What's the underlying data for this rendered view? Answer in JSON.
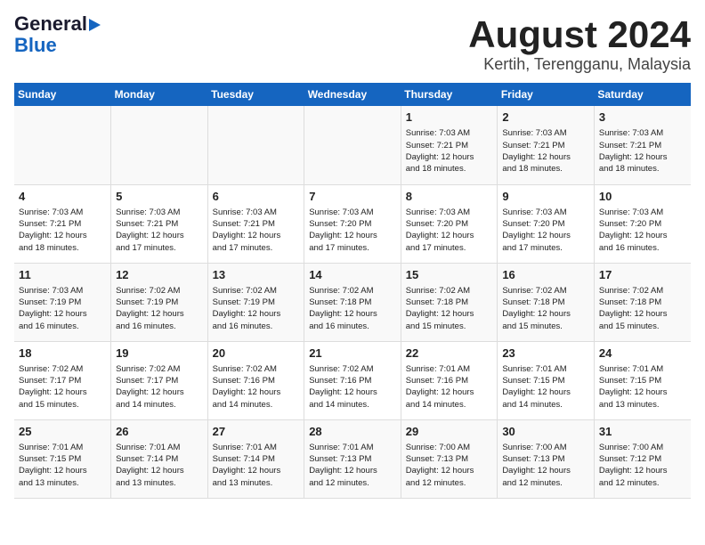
{
  "header": {
    "logo_line1": "General",
    "logo_line2": "Blue",
    "title": "August 2024",
    "subtitle": "Kertih, Terengganu, Malaysia"
  },
  "weekdays": [
    "Sunday",
    "Monday",
    "Tuesday",
    "Wednesday",
    "Thursday",
    "Friday",
    "Saturday"
  ],
  "weeks": [
    [
      {
        "day": "",
        "info": ""
      },
      {
        "day": "",
        "info": ""
      },
      {
        "day": "",
        "info": ""
      },
      {
        "day": "",
        "info": ""
      },
      {
        "day": "1",
        "info": "Sunrise: 7:03 AM\nSunset: 7:21 PM\nDaylight: 12 hours\nand 18 minutes."
      },
      {
        "day": "2",
        "info": "Sunrise: 7:03 AM\nSunset: 7:21 PM\nDaylight: 12 hours\nand 18 minutes."
      },
      {
        "day": "3",
        "info": "Sunrise: 7:03 AM\nSunset: 7:21 PM\nDaylight: 12 hours\nand 18 minutes."
      }
    ],
    [
      {
        "day": "4",
        "info": "Sunrise: 7:03 AM\nSunset: 7:21 PM\nDaylight: 12 hours\nand 18 minutes."
      },
      {
        "day": "5",
        "info": "Sunrise: 7:03 AM\nSunset: 7:21 PM\nDaylight: 12 hours\nand 17 minutes."
      },
      {
        "day": "6",
        "info": "Sunrise: 7:03 AM\nSunset: 7:21 PM\nDaylight: 12 hours\nand 17 minutes."
      },
      {
        "day": "7",
        "info": "Sunrise: 7:03 AM\nSunset: 7:20 PM\nDaylight: 12 hours\nand 17 minutes."
      },
      {
        "day": "8",
        "info": "Sunrise: 7:03 AM\nSunset: 7:20 PM\nDaylight: 12 hours\nand 17 minutes."
      },
      {
        "day": "9",
        "info": "Sunrise: 7:03 AM\nSunset: 7:20 PM\nDaylight: 12 hours\nand 17 minutes."
      },
      {
        "day": "10",
        "info": "Sunrise: 7:03 AM\nSunset: 7:20 PM\nDaylight: 12 hours\nand 16 minutes."
      }
    ],
    [
      {
        "day": "11",
        "info": "Sunrise: 7:03 AM\nSunset: 7:19 PM\nDaylight: 12 hours\nand 16 minutes."
      },
      {
        "day": "12",
        "info": "Sunrise: 7:02 AM\nSunset: 7:19 PM\nDaylight: 12 hours\nand 16 minutes."
      },
      {
        "day": "13",
        "info": "Sunrise: 7:02 AM\nSunset: 7:19 PM\nDaylight: 12 hours\nand 16 minutes."
      },
      {
        "day": "14",
        "info": "Sunrise: 7:02 AM\nSunset: 7:18 PM\nDaylight: 12 hours\nand 16 minutes."
      },
      {
        "day": "15",
        "info": "Sunrise: 7:02 AM\nSunset: 7:18 PM\nDaylight: 12 hours\nand 15 minutes."
      },
      {
        "day": "16",
        "info": "Sunrise: 7:02 AM\nSunset: 7:18 PM\nDaylight: 12 hours\nand 15 minutes."
      },
      {
        "day": "17",
        "info": "Sunrise: 7:02 AM\nSunset: 7:18 PM\nDaylight: 12 hours\nand 15 minutes."
      }
    ],
    [
      {
        "day": "18",
        "info": "Sunrise: 7:02 AM\nSunset: 7:17 PM\nDaylight: 12 hours\nand 15 minutes."
      },
      {
        "day": "19",
        "info": "Sunrise: 7:02 AM\nSunset: 7:17 PM\nDaylight: 12 hours\nand 14 minutes."
      },
      {
        "day": "20",
        "info": "Sunrise: 7:02 AM\nSunset: 7:16 PM\nDaylight: 12 hours\nand 14 minutes."
      },
      {
        "day": "21",
        "info": "Sunrise: 7:02 AM\nSunset: 7:16 PM\nDaylight: 12 hours\nand 14 minutes."
      },
      {
        "day": "22",
        "info": "Sunrise: 7:01 AM\nSunset: 7:16 PM\nDaylight: 12 hours\nand 14 minutes."
      },
      {
        "day": "23",
        "info": "Sunrise: 7:01 AM\nSunset: 7:15 PM\nDaylight: 12 hours\nand 14 minutes."
      },
      {
        "day": "24",
        "info": "Sunrise: 7:01 AM\nSunset: 7:15 PM\nDaylight: 12 hours\nand 13 minutes."
      }
    ],
    [
      {
        "day": "25",
        "info": "Sunrise: 7:01 AM\nSunset: 7:15 PM\nDaylight: 12 hours\nand 13 minutes."
      },
      {
        "day": "26",
        "info": "Sunrise: 7:01 AM\nSunset: 7:14 PM\nDaylight: 12 hours\nand 13 minutes."
      },
      {
        "day": "27",
        "info": "Sunrise: 7:01 AM\nSunset: 7:14 PM\nDaylight: 12 hours\nand 13 minutes."
      },
      {
        "day": "28",
        "info": "Sunrise: 7:01 AM\nSunset: 7:13 PM\nDaylight: 12 hours\nand 12 minutes."
      },
      {
        "day": "29",
        "info": "Sunrise: 7:00 AM\nSunset: 7:13 PM\nDaylight: 12 hours\nand 12 minutes."
      },
      {
        "day": "30",
        "info": "Sunrise: 7:00 AM\nSunset: 7:13 PM\nDaylight: 12 hours\nand 12 minutes."
      },
      {
        "day": "31",
        "info": "Sunrise: 7:00 AM\nSunset: 7:12 PM\nDaylight: 12 hours\nand 12 minutes."
      }
    ]
  ]
}
